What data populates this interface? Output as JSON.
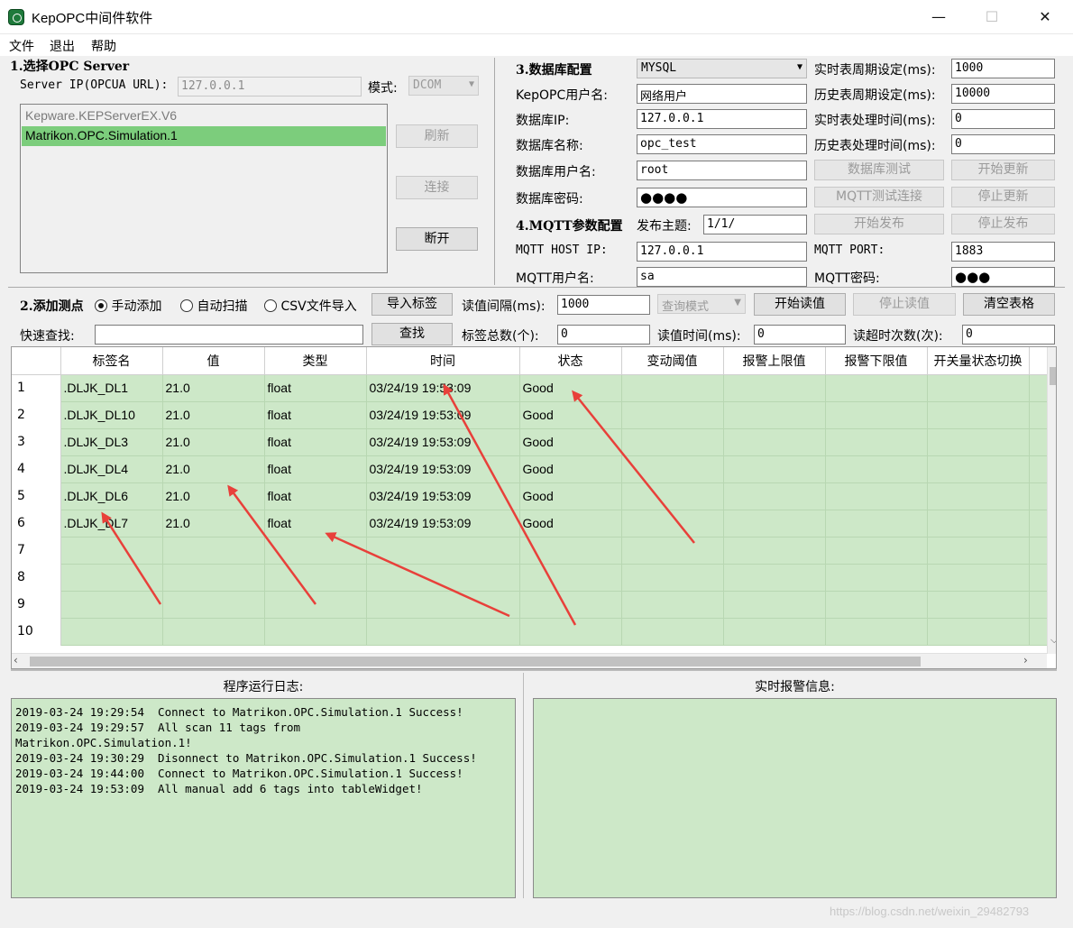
{
  "window": {
    "title": "KepOPC中间件软件",
    "min": "—",
    "max": "☐",
    "close": "✕"
  },
  "menu": [
    "文件",
    "退出",
    "帮助"
  ],
  "opc": {
    "title": "1.选择OPC Server",
    "ip_label": "Server IP(OPCUA URL):",
    "ip_value": "127.0.0.1",
    "mode_label": "模式:",
    "mode_value": "DCOM",
    "servers": [
      "Kepware.KEPServerEX.V6",
      "Matrikon.OPC.Simulation.1"
    ],
    "selected_index": 1,
    "refresh": "刷新",
    "connect": "连接",
    "disconnect": "断开"
  },
  "db": {
    "title": "3.数据库配置",
    "type_value": "MYSQL",
    "user_label": "KepOPC用户名:",
    "user_value": "网络用户",
    "ip_label": "数据库IP:",
    "ip_value": "127.0.0.1",
    "name_label": "数据库名称:",
    "name_value": "opc_test",
    "db_user_label": "数据库用户名:",
    "db_user_value": "root",
    "pwd_label": "数据库密码:",
    "pwd_value": "●●●●",
    "rt_period_label": "实时表周期设定(ms):",
    "rt_period_value": "1000",
    "hist_period_label": "历史表周期设定(ms):",
    "hist_period_value": "10000",
    "rt_proc_label": "实时表处理时间(ms):",
    "rt_proc_value": "0",
    "hist_proc_label": "历史表处理时间(ms):",
    "hist_proc_value": "0",
    "test_btn": "数据库测试",
    "start_update": "开始更新",
    "mqtt_test": "MQTT测试连接",
    "stop_update": "停止更新"
  },
  "mqtt": {
    "title": "4.MQTT参数配置",
    "topic_label": "发布主题:",
    "topic_value": "1/1/",
    "start_pub": "开始发布",
    "stop_pub": "停止发布",
    "host_label": "MQTT HOST IP:",
    "host_value": "127.0.0.1",
    "port_label": "MQTT PORT:",
    "port_value": "1883",
    "user_label": "MQTT用户名:",
    "user_value": "sa",
    "pwd_label": "MQTT密码:",
    "pwd_value": "●●●"
  },
  "tags": {
    "title": "2.添加测点",
    "manual": "手动添加",
    "auto": "自动扫描",
    "csv": "CSV文件导入",
    "import_btn": "导入标签",
    "interval_label": "读值间隔(ms):",
    "interval_value": "1000",
    "query_mode": "查询模式",
    "start_read": "开始读值",
    "stop_read": "停止读值",
    "clear": "清空表格",
    "search_label": "快速查找:",
    "search_value": "",
    "search_btn": "查找",
    "total_label": "标签总数(个):",
    "total_value": "0",
    "read_time_label": "读值时间(ms):",
    "read_time_value": "0",
    "timeout_label": "读超时次数(次):",
    "timeout_value": "0"
  },
  "table": {
    "headers": [
      "标签名",
      "值",
      "类型",
      "时间",
      "状态",
      "变动阈值",
      "报警上限值",
      "报警下限值",
      "开关量状态切换"
    ],
    "rows": [
      [
        ".DLJK_DL1",
        "21.0",
        "float",
        "03/24/19 19:53:09",
        "Good"
      ],
      [
        ".DLJK_DL10",
        "21.0",
        "float",
        "03/24/19 19:53:09",
        "Good"
      ],
      [
        ".DLJK_DL3",
        "21.0",
        "float",
        "03/24/19 19:53:09",
        "Good"
      ],
      [
        ".DLJK_DL4",
        "21.0",
        "float",
        "03/24/19 19:53:09",
        "Good"
      ],
      [
        ".DLJK_DL6",
        "21.0",
        "float",
        "03/24/19 19:53:09",
        "Good"
      ],
      [
        ".DLJK_DL7",
        "21.0",
        "float",
        "03/24/19 19:53:09",
        "Good"
      ],
      [
        "",
        "",
        "",
        "",
        ""
      ],
      [
        "",
        "",
        "",
        "",
        ""
      ],
      [
        "",
        "",
        "",
        "",
        ""
      ],
      [
        "",
        "",
        "",
        "",
        ""
      ]
    ],
    "row_numbers": [
      "1",
      "2",
      "3",
      "4",
      "5",
      "6",
      "7",
      "8",
      "9",
      "10"
    ]
  },
  "log": {
    "title": "程序运行日志:",
    "text": "2019-03-24 19:29:54  Connect to Matrikon.OPC.Simulation.1 Success!\n2019-03-24 19:29:57  All scan 11 tags from\nMatrikon.OPC.Simulation.1!\n2019-03-24 19:30:29  Disonnect to Matrikon.OPC.Simulation.1 Success!\n2019-03-24 19:44:00  Connect to Matrikon.OPC.Simulation.1 Success!\n2019-03-24 19:53:09  All manual add 6 tags into tableWidget!"
  },
  "alarm": {
    "title": "实时报警信息:"
  },
  "watermark": "https://blog.csdn.net/weixin_29482793",
  "colors": {
    "grid_green": "#cde8c8",
    "selected_green": "#7ccd7c",
    "annotation_red": "#e8403a"
  }
}
